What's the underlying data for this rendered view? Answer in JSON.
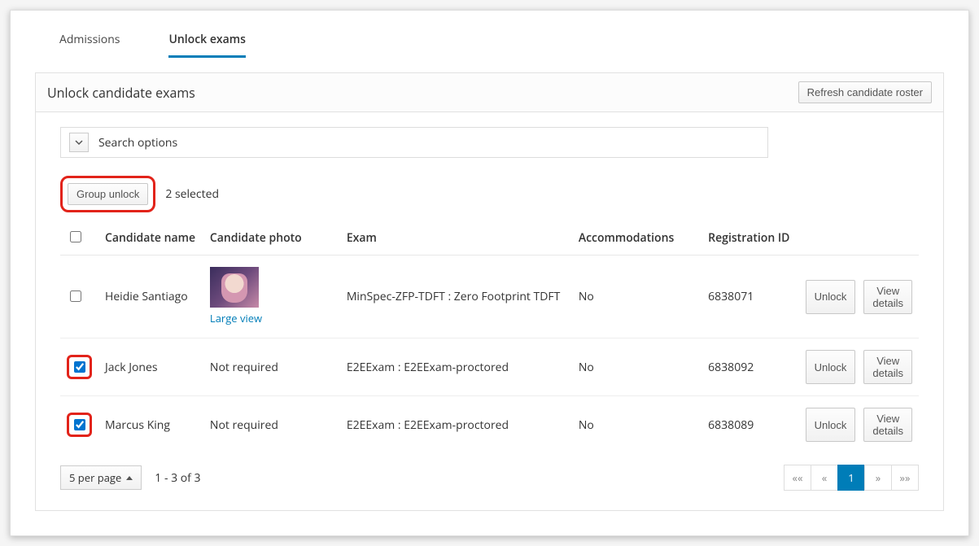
{
  "tabs": {
    "admissions": "Admissions",
    "unlock": "Unlock exams"
  },
  "panel": {
    "title": "Unlock candidate exams",
    "refresh_btn": "Refresh candidate roster"
  },
  "search": {
    "label": "Search options"
  },
  "groupUnlock": {
    "label": "Group unlock",
    "selected_text": "2 selected"
  },
  "headers": {
    "name": "Candidate name",
    "photo": "Candidate photo",
    "exam": "Exam",
    "accom": "Accommodations",
    "reg": "Registration ID"
  },
  "rows": [
    {
      "checked": false,
      "highlight": false,
      "name": "Heidie Santiago",
      "photo_required": true,
      "photo_link": "Large view",
      "exam": "MinSpec-ZFP-TDFT : Zero Footprint TDFT",
      "accom": "No",
      "reg": "6838071",
      "unlock": "Unlock",
      "details": "View details"
    },
    {
      "checked": true,
      "highlight": true,
      "name": "Jack Jones",
      "photo_required": false,
      "photo_text": "Not required",
      "exam": "E2EExam : E2EExam-proctored",
      "accom": "No",
      "reg": "6838092",
      "unlock": "Unlock",
      "details": "View details"
    },
    {
      "checked": true,
      "highlight": true,
      "name": "Marcus King",
      "photo_required": false,
      "photo_text": "Not required",
      "exam": "E2EExam : E2EExam-proctored",
      "accom": "No",
      "reg": "6838089",
      "unlock": "Unlock",
      "details": "View details"
    }
  ],
  "footer": {
    "per_page": "5 per page",
    "range": "1 - 3 of 3",
    "pages": {
      "first": "««",
      "prev": "«",
      "current": "1",
      "next": "»",
      "last": "»»"
    }
  }
}
